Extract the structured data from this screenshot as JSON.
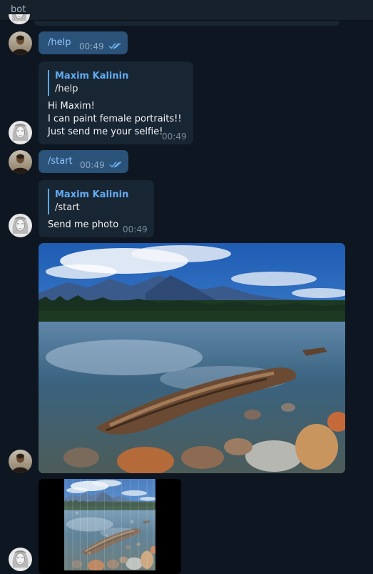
{
  "header": {
    "title": "bot"
  },
  "messages": [
    {
      "type": "outgoing",
      "text": "/help",
      "time": "00:49",
      "status": "read"
    },
    {
      "type": "incoming",
      "reply_name": "Maxim Kalinin",
      "reply_text": "/help",
      "lines": [
        "Hi Maxim!",
        "I can paint female portraits!!",
        "Just send me your selfie!"
      ],
      "time": "00:49"
    },
    {
      "type": "outgoing",
      "text": "/start",
      "time": "00:49",
      "status": "read"
    },
    {
      "type": "incoming",
      "reply_name": "Maxim Kalinin",
      "reply_text": "/start",
      "lines": [
        "Send me photo"
      ],
      "time": "00:49"
    },
    {
      "type": "outgoing-photo",
      "image": "mountain-lake-photo"
    },
    {
      "type": "incoming-photo",
      "image": "stylized-mountain-lake-photo"
    }
  ],
  "colors": {
    "background": "#0e1621",
    "outgoing_bubble": "#2b5278",
    "incoming_bubble": "#182533",
    "link": "#8fc2ff",
    "reply_accent": "#5fa7e6"
  }
}
